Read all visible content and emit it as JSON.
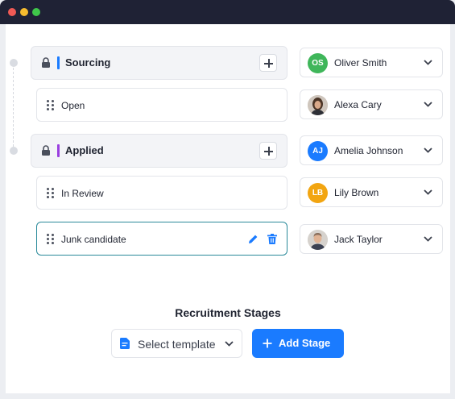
{
  "stages": [
    {
      "label": "Sourcing",
      "accent": "#1a7bff",
      "assignee": {
        "name": "Oliver Smith",
        "initials": "OS",
        "color": "#3fb65a"
      },
      "sub": {
        "label": "Open",
        "assignee": {
          "name": "Alexa Cary",
          "photo": true
        }
      }
    },
    {
      "label": "Applied",
      "accent": "#9a3fe0",
      "assignee": {
        "name": "Amelia Johnson",
        "initials": "AJ",
        "color": "#1a7bff"
      },
      "subs": [
        {
          "label": "In Review",
          "assignee": {
            "name": "Lily Brown",
            "initials": "LB",
            "color": "#f2a511"
          }
        },
        {
          "label": "Junk candidate",
          "assignee": {
            "name": "Jack Taylor",
            "photo": true
          }
        }
      ]
    }
  ],
  "footer": {
    "title": "Recruitment Stages",
    "template_select": "Select template",
    "add_stage": "Add Stage"
  },
  "icons": {
    "lock": "lock-icon",
    "plus": "plus-icon",
    "grip": "drag-handle-icon",
    "edit": "pencil-icon",
    "delete": "trash-icon",
    "chevron": "chevron-down-icon",
    "document": "document-icon"
  }
}
